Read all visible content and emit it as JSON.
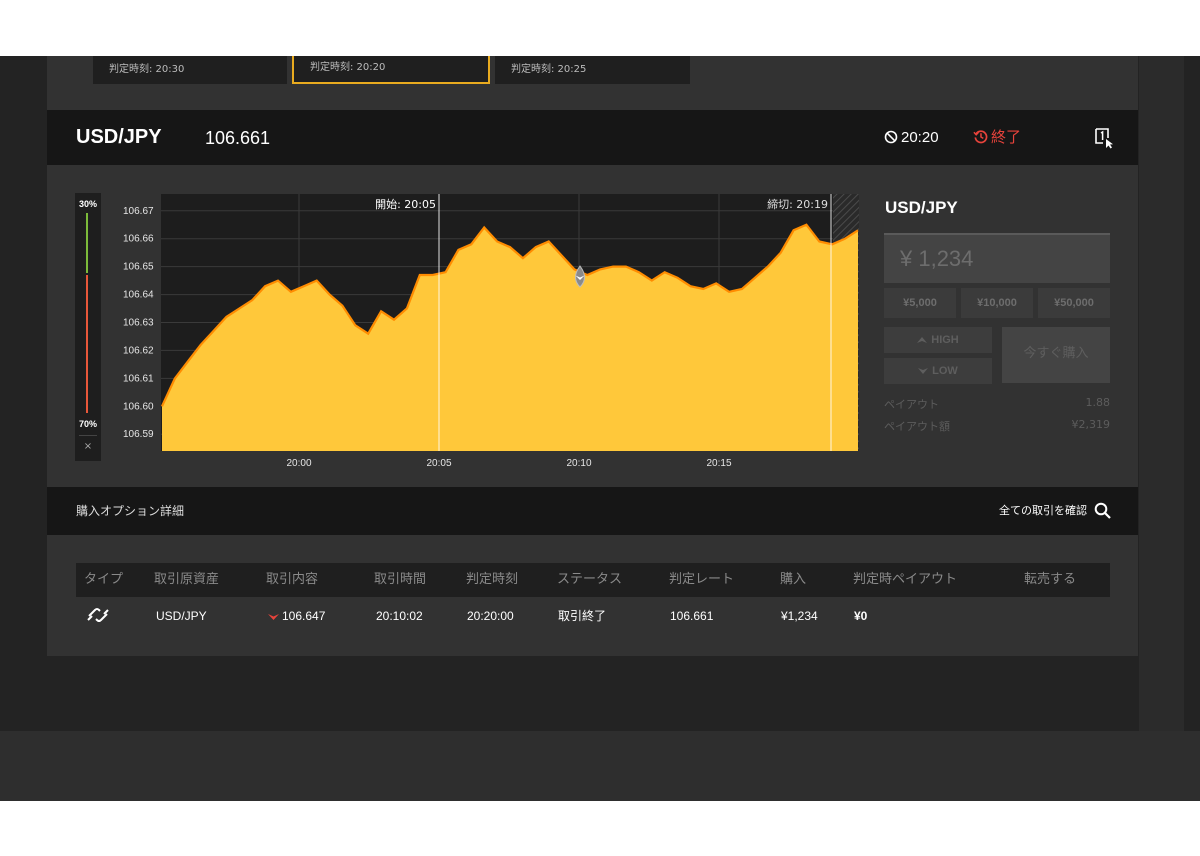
{
  "cards": [
    {
      "label": "判定時刻: 20:30"
    },
    {
      "label": "判定時刻: 20:20"
    },
    {
      "label": "判定時刻: 20:25"
    }
  ],
  "header": {
    "pair": "USD/JPY",
    "rate": "106.661",
    "expiry": "20:20",
    "status": "終了",
    "colors": {
      "status": "#e8433b",
      "accent": "#e9ab1f"
    }
  },
  "gauge": {
    "top_label": "30%",
    "bottom_label": "70%",
    "close": "×"
  },
  "chart_data": {
    "type": "area",
    "y_ticks": [
      "106.67",
      "106.66",
      "106.65",
      "106.64",
      "106.63",
      "106.62",
      "106.61",
      "106.60",
      "106.59"
    ],
    "ylim": [
      106.584,
      106.676
    ],
    "x_ticks": [
      "20:00",
      "20:05",
      "20:10",
      "20:15"
    ],
    "start_label": "開始: 20:05",
    "end_label": "締切: 20:19",
    "fill_color": "#ffc83a",
    "line_color": "#ff8c00",
    "values": [
      106.6,
      106.61,
      106.616,
      106.622,
      106.627,
      106.632,
      106.635,
      106.638,
      106.643,
      106.645,
      106.641,
      106.643,
      106.645,
      106.64,
      106.636,
      106.629,
      106.626,
      106.634,
      106.631,
      106.635,
      106.647,
      106.647,
      106.648,
      106.656,
      106.658,
      106.664,
      106.659,
      106.657,
      106.653,
      106.657,
      106.659,
      106.654,
      106.649,
      106.647,
      106.649,
      106.65,
      106.65,
      106.648,
      106.645,
      106.648,
      106.646,
      106.643,
      106.642,
      106.644,
      106.641,
      106.642,
      106.646,
      106.65,
      106.655,
      106.663,
      106.665,
      106.659,
      106.658,
      106.66,
      106.663
    ],
    "entry_marker": {
      "value": 106.647
    }
  },
  "trade": {
    "title": "USD/JPY",
    "amount": "¥ 1,234",
    "quick": [
      "¥5,000",
      "¥10,000",
      "¥50,000"
    ],
    "high": "HIGH",
    "low": "LOW",
    "buy": "今すぐ購入",
    "payout_label": "ペイアウト",
    "payout_value": "1.88",
    "payout_amount_label": "ペイアウト額",
    "payout_amount_value": "¥2,319"
  },
  "section": {
    "title": "購入オプション詳細",
    "link": "全ての取引を確認"
  },
  "table": {
    "headers": [
      "タイプ",
      "取引原資産",
      "取引内容",
      "取引時間",
      "判定時刻",
      "ステータス",
      "判定レート",
      "購入",
      "判定時ペイアウト",
      "転売する"
    ],
    "row": {
      "asset": "USD/JPY",
      "content": "106.647",
      "time": "20:10:02",
      "judge": "20:20:00",
      "status": "取引終了",
      "rate": "106.661",
      "purchase": "¥1,234",
      "payout": "¥0"
    }
  }
}
